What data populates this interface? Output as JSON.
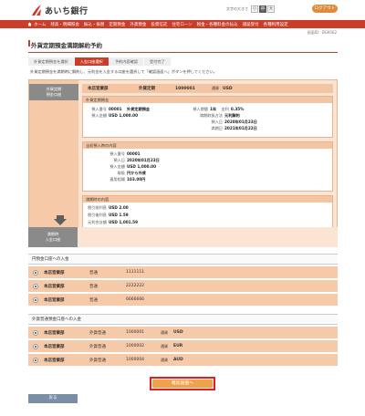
{
  "header": {
    "bank_name": "あいち銀行",
    "font_size_label": "文字の大きさ",
    "font_sizes": [
      "小",
      "中",
      "大"
    ],
    "logout_label": "ログアウト"
  },
  "nav": {
    "items": [
      "ホーム",
      "残高・明細照会",
      "振込・振替",
      "定期預金",
      "外貨預金",
      "投資信託",
      "住宅ローン",
      "税金・各種料金の払込",
      "諸届受付",
      "各種利用設定"
    ]
  },
  "screen_id": "画面ID：BGK002",
  "page_title": "外貨定期預金満期解約予約",
  "steps": [
    "外貨定期預金を選択",
    "入金口座選択",
    "予約内容確認",
    "受付完了"
  ],
  "instruction": "外貨定期預金を満期時に解約し、元利金を入金する口座を選択して「確認画面へ」ボタンを押してください。",
  "source": {
    "label_line1": "外貨定期",
    "label_line2": "預金口座",
    "account": {
      "branch": "本店営業部",
      "type": "外貨定期",
      "number": "1000001",
      "currency_label": "通貨",
      "currency": "USD"
    },
    "deposit": {
      "head": "外貨定期預金",
      "deposit_no_label": "預入番号",
      "deposit_no": "00001",
      "product": "外貨定期預金",
      "amount_label": "預入金額",
      "amount": "USD 1,000.00",
      "term_label": "預入期間",
      "term": "1年",
      "rate_label": "金利",
      "rate": "0.35%",
      "maturity_method_label": "満期取扱方法",
      "maturity_method": "元利解約",
      "deposit_date_label": "預入日",
      "deposit_date": "2020年01月23日",
      "maturity_date_label": "満期日",
      "maturity_date": "2021年01月22日"
    },
    "contract": {
      "head": "当初預入時の内容",
      "no_label": "預入番号",
      "no": "00001",
      "date_label": "預入日",
      "date": "2020年01月23日",
      "amount_label": "預入金額",
      "amount": "USD 1,000.00",
      "currency_label": "取扱",
      "currency": "円から外貨",
      "rate_label": "適用相場",
      "rate": "103.00円"
    },
    "maturity": {
      "head": "満期時の内容",
      "interest_label": "税引前利息",
      "interest": "USD 2.00",
      "after_tax_label": "税引後利息",
      "after_tax": "USD 1.59",
      "total_label": "元利合計額",
      "total": "USD 1,001.59"
    }
  },
  "target": {
    "label_line1": "満期時",
    "label_line2": "入金口座"
  },
  "yen_section": {
    "title": "円預金口座への入金",
    "rows": [
      {
        "branch": "本店営業部",
        "type": "普通",
        "number": "1111111"
      },
      {
        "branch": "本店営業部",
        "type": "普通",
        "number": "2222222"
      },
      {
        "branch": "本店営業部",
        "type": "普通",
        "number": "6666666"
      }
    ]
  },
  "fx_section": {
    "title": "外貨普通預金口座への入金",
    "currency_label": "通貨",
    "rows": [
      {
        "branch": "本店営業部",
        "type": "外貨普通",
        "number": "1000001",
        "currency": "USD"
      },
      {
        "branch": "本店営業部",
        "type": "外貨普通",
        "number": "1000002",
        "currency": "EUR"
      },
      {
        "branch": "本店営業部",
        "type": "外貨普通",
        "number": "1000004",
        "currency": "AUD"
      }
    ]
  },
  "buttons": {
    "confirm": "確認画面へ",
    "back": "戻る"
  }
}
